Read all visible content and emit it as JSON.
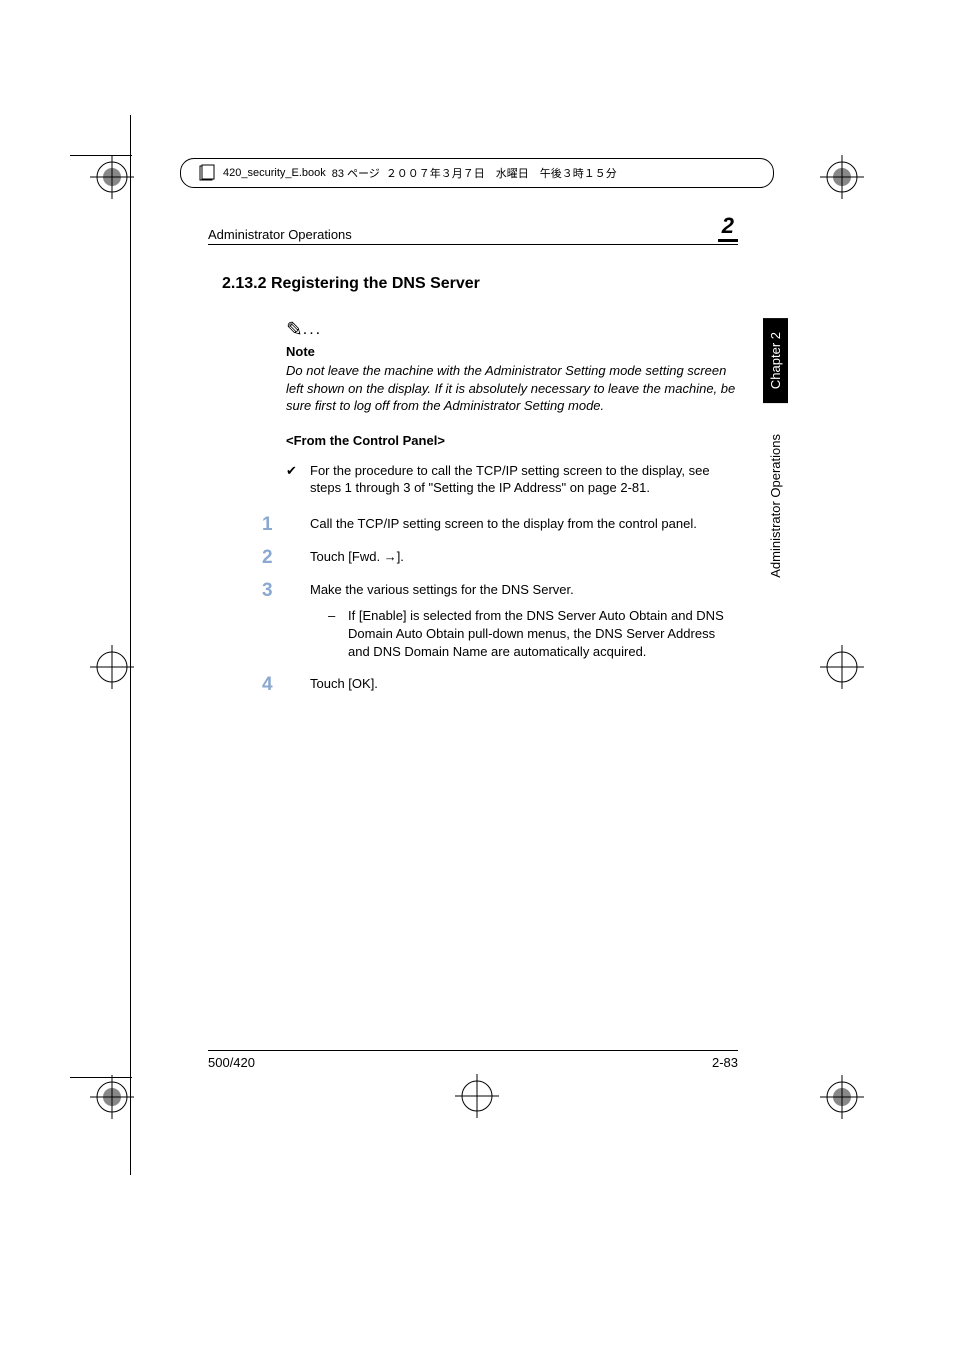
{
  "file_header": {
    "filename": "420_security_E.book",
    "page_label": "83 ページ",
    "date": "２００７年３月７日　水曜日　午後３時１５分"
  },
  "running_header": "Administrator Operations",
  "chapter_number": "2",
  "section": {
    "number": "2.13.2",
    "title": "Registering the DNS Server"
  },
  "note": {
    "label": "Note",
    "body": "Do not leave the machine with the Administrator Setting mode setting screen left shown on the display. If it is absolutely necessary to leave the machine, be sure first to log off from the Administrator Setting mode."
  },
  "subheading": "<From the Control Panel>",
  "check_item": "For the procedure to call the TCP/IP setting screen to the display, see steps 1 through 3 of \"Setting the IP Address\" on page 2-81.",
  "steps": [
    {
      "num": "1",
      "text": "Call the TCP/IP setting screen to the display from the control panel."
    },
    {
      "num": "2",
      "text": "Touch [Fwd. →]."
    },
    {
      "num": "3",
      "text": "Make the various settings for the DNS Server.",
      "sub": "If [Enable] is selected from the DNS Server Auto Obtain and DNS Domain Auto Obtain pull-down menus, the DNS Server Address and DNS Domain Name are automatically acquired."
    },
    {
      "num": "4",
      "text": "Touch [OK]."
    }
  ],
  "side_tabs": {
    "chapter": "Chapter 2",
    "section": "Administrator Operations"
  },
  "footer": {
    "left": "500/420",
    "right": "2-83"
  }
}
